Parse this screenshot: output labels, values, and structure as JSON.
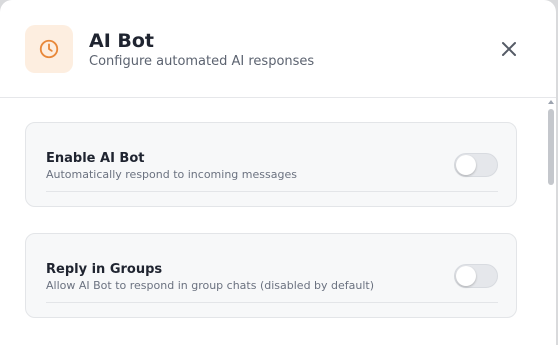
{
  "header": {
    "title": "AI Bot",
    "subtitle": "Configure automated AI responses",
    "icon": "clock-icon",
    "accent_color": "#e8883a",
    "icon_bg": "#fdeee0"
  },
  "settings": [
    {
      "title": "Enable AI Bot",
      "description": "Automatically respond to incoming messages",
      "enabled": false
    },
    {
      "title": "Reply in Groups",
      "description": "Allow AI Bot to respond in group chats (disabled by default)",
      "enabled": false
    }
  ],
  "icons": {
    "close": "close-icon"
  }
}
